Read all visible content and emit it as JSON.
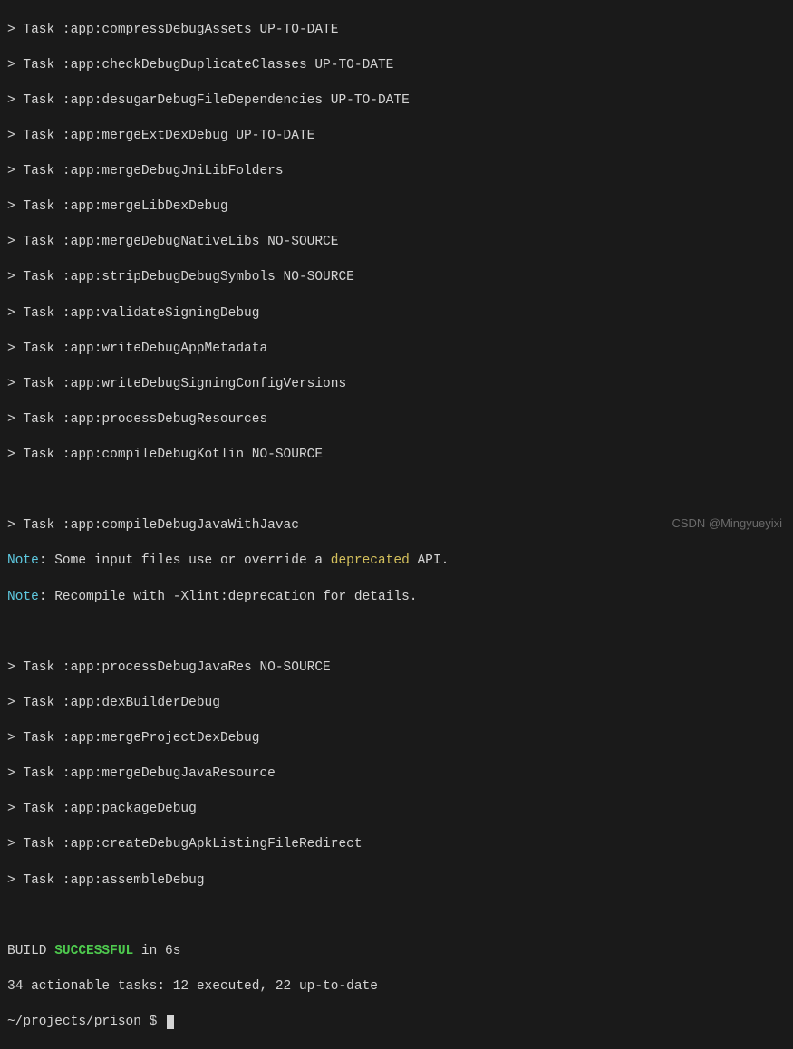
{
  "tasks_block1": [
    "> Task :app:compressDebugAssets UP-TO-DATE",
    "> Task :app:checkDebugDuplicateClasses UP-TO-DATE",
    "> Task :app:desugarDebugFileDependencies UP-TO-DATE",
    "> Task :app:mergeExtDexDebug UP-TO-DATE",
    "> Task :app:mergeDebugJniLibFolders",
    "> Task :app:mergeLibDexDebug",
    "> Task :app:mergeDebugNativeLibs NO-SOURCE",
    "> Task :app:stripDebugDebugSymbols NO-SOURCE",
    "> Task :app:validateSigningDebug",
    "> Task :app:writeDebugAppMetadata",
    "> Task :app:writeDebugSigningConfigVersions",
    "> Task :app:processDebugResources",
    "> Task :app:compileDebugKotlin NO-SOURCE"
  ],
  "compile_task": "> Task :app:compileDebugJavaWithJavac",
  "notes": {
    "note_label": "Note",
    "note1_text": ": Some input files use or override a ",
    "deprecated_word": "deprecated",
    "note1_suffix": " API.",
    "note2_text": ": Recompile with -Xlint:deprecation for details."
  },
  "tasks_block2": [
    "> Task :app:processDebugJavaRes NO-SOURCE",
    "> Task :app:dexBuilderDebug",
    "> Task :app:mergeProjectDexDebug",
    "> Task :app:mergeDebugJavaResource",
    "> Task :app:packageDebug",
    "> Task :app:createDebugApkListingFileRedirect",
    "> Task :app:assembleDebug"
  ],
  "build_result": {
    "prefix": "BUILD ",
    "status": "SUCCESSFUL",
    "suffix": " in 6s"
  },
  "summary": "34 actionable tasks: 12 executed, 22 up-to-date",
  "prompt": {
    "path": "~/projects/prison",
    "symbol": " $ "
  },
  "watermark": "CSDN @Mingyueyixi"
}
